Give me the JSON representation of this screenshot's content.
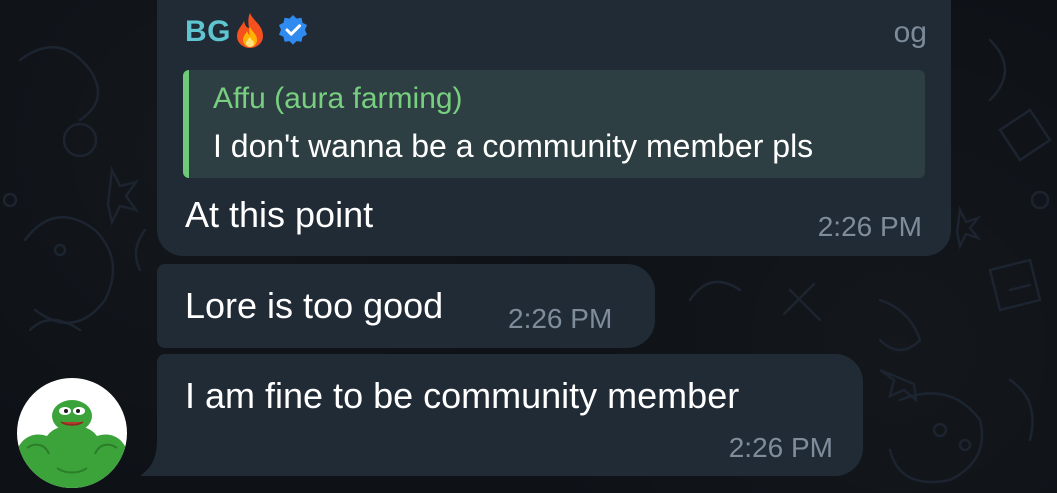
{
  "messages": [
    {
      "sender": "BG",
      "sender_emoji": "fire-icon",
      "verified": true,
      "role": "og",
      "reply": {
        "author": "Affu (aura farming)",
        "text": "I don't wanna be a community member pls"
      },
      "text": "At this point",
      "time": "2:26 PM"
    },
    {
      "text": "Lore is too good",
      "time": "2:26 PM"
    },
    {
      "text": "I am fine to be community member",
      "time": "2:26 PM"
    }
  ],
  "avatar": {
    "icon": "pepe-frog-avatar",
    "bg_color": "#ffffff",
    "frog_color": "#3ba33a"
  },
  "colors": {
    "bubble": "#212b36",
    "sender_name": "#5fc5d0",
    "reply_bg": "#2e3f43",
    "reply_accent": "#6ec978",
    "timestamp": "#7f8d9b",
    "verified": "#2f8bf0"
  }
}
